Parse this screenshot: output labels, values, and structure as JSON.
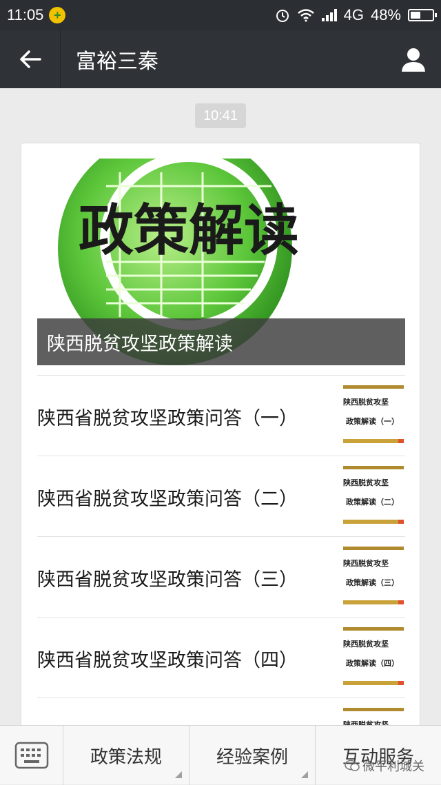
{
  "status_bar": {
    "time": "11:05",
    "network": "4G",
    "battery": "48%",
    "battery_level": 0.48
  },
  "nav": {
    "title": "富裕三秦"
  },
  "message_time": "10:41",
  "cover": {
    "image_text": "政策解读",
    "title": "陕西脱贫攻坚政策解读"
  },
  "articles": [
    {
      "title": "陕西省脱贫攻坚政策问答（一）",
      "thumb_line1": "陕西脱贫攻坚",
      "thumb_line2": "政策解读（一）"
    },
    {
      "title": "陕西省脱贫攻坚政策问答（二）",
      "thumb_line1": "陕西脱贫攻坚",
      "thumb_line2": "政策解读（二）"
    },
    {
      "title": "陕西省脱贫攻坚政策问答（三）",
      "thumb_line1": "陕西脱贫攻坚",
      "thumb_line2": "政策解读（三）"
    },
    {
      "title": "陕西省脱贫攻坚政策问答（四）",
      "thumb_line1": "陕西脱贫攻坚",
      "thumb_line2": "政策解读（四）"
    },
    {
      "title": "",
      "thumb_line1": "陕西脱贫攻坚",
      "thumb_line2": ""
    }
  ],
  "menu": {
    "items": [
      "政策法规",
      "经验案例",
      "互动服务"
    ]
  },
  "watermark": "微平利城关",
  "colors": {
    "nav_bg": "#2f3337",
    "status_bg": "#2b2f33",
    "page_bg": "#ebebeb",
    "cover_green": "#5cc63a",
    "thumb_gold": "#c9a23a"
  }
}
